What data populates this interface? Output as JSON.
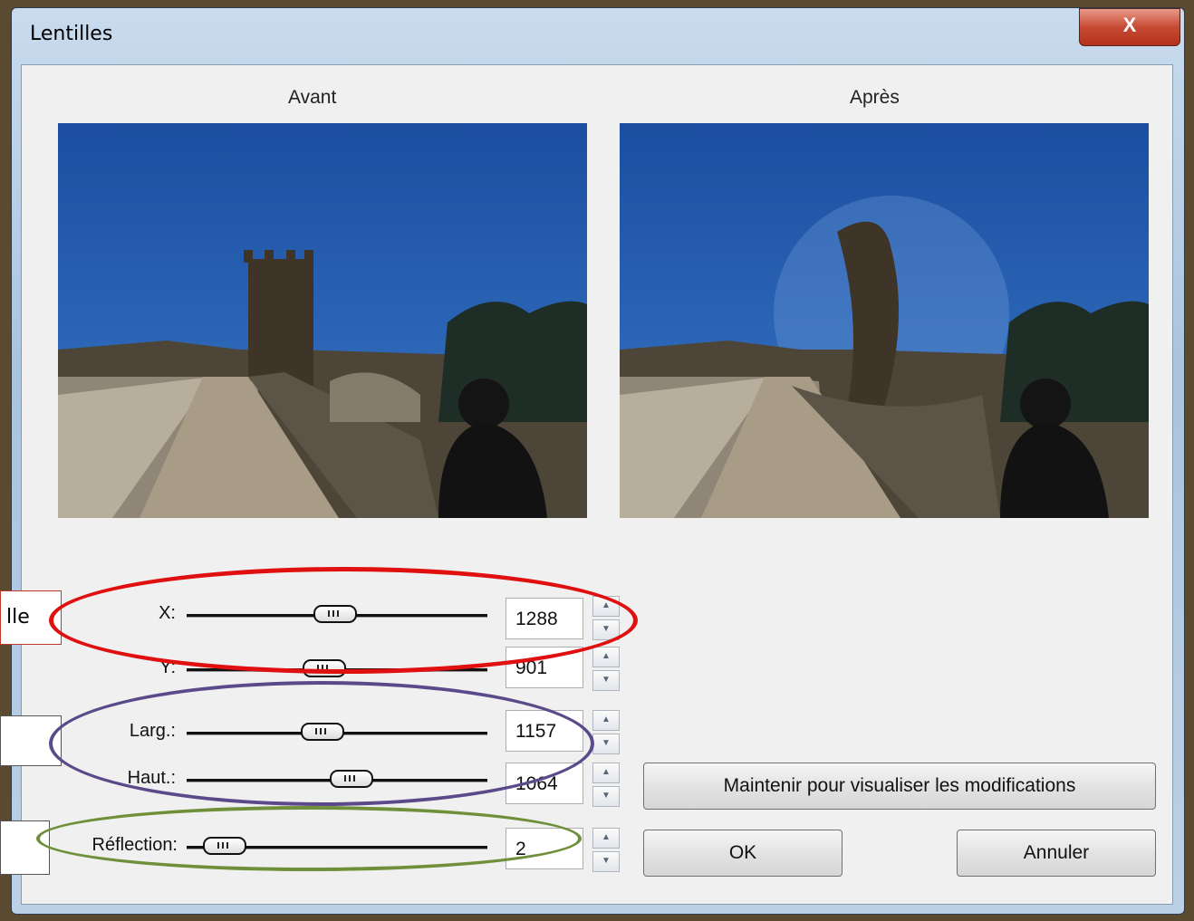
{
  "window": {
    "title": "Lentilles",
    "close_label": "X"
  },
  "preview": {
    "before_label": "Avant",
    "after_label": "Après"
  },
  "controls": [
    {
      "label": "X:",
      "value": "1288",
      "level": 0.5
    },
    {
      "label": "Y:",
      "value": "901",
      "level": 0.46
    },
    {
      "label": "Larg.:",
      "value": "1157",
      "level": 0.44
    },
    {
      "label": "Haut.:",
      "value": "1064",
      "level": 0.53
    },
    {
      "label": "Réflection:",
      "value": "2",
      "level": 0.08
    }
  ],
  "buttons": {
    "preview_label": "Maintenir pour visualiser les modifications",
    "ok_label": "OK",
    "cancel_label": "Annuler"
  },
  "annotations": {
    "position_tag": "lle",
    "size_tag": "",
    "reflection_tag": "",
    "colors": {
      "position": "#e01010",
      "size": "#5b4a8a",
      "reflection": "#6f8f3a",
      "tag_border": "#c0392b"
    }
  }
}
